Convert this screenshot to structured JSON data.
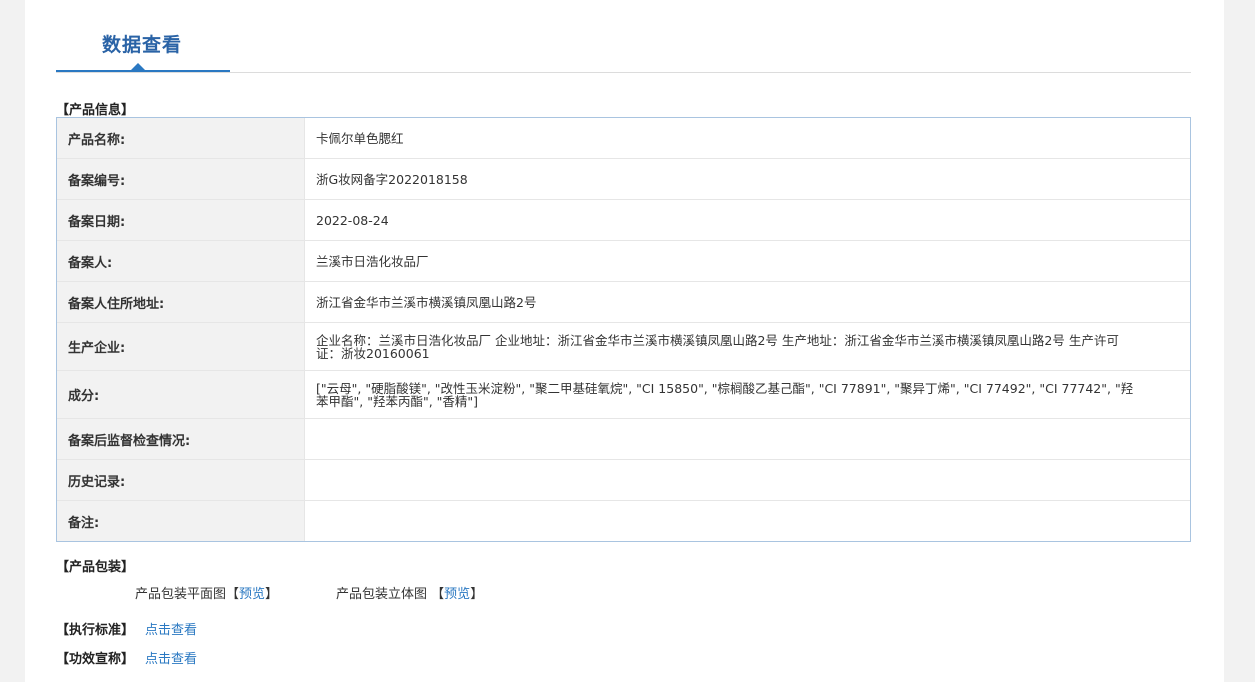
{
  "tab": {
    "title": "数据查看"
  },
  "sections": {
    "product_info": "【产品信息】",
    "product_packaging": "【产品包装】",
    "standard": "【执行标准】",
    "efficacy": "【功效宣称】"
  },
  "info_rows": [
    {
      "key": "产品名称:",
      "value": "卡佩尔单色腮红"
    },
    {
      "key": "备案编号:",
      "value": "浙G妆网备字2022018158"
    },
    {
      "key": "备案日期:",
      "value": "2022-08-24"
    },
    {
      "key": "备案人:",
      "value": "兰溪市日浩化妆品厂"
    },
    {
      "key": "备案人住所地址:",
      "value": "浙江省金华市兰溪市横溪镇凤凰山路2号"
    },
    {
      "key": "生产企业:",
      "value": "企业名称：兰溪市日浩化妆品厂 企业地址：浙江省金华市兰溪市横溪镇凤凰山路2号 生产地址：浙江省金华市兰溪市横溪镇凤凰山路2号 生产许可证：浙妆20160061"
    },
    {
      "key": "成分:",
      "value": "[\"云母\", \"硬脂酸镁\", \"改性玉米淀粉\", \"聚二甲基硅氧烷\", \"CI 15850\", \"棕榈酸乙基己酯\", \"CI 77891\", \"聚异丁烯\", \"CI 77492\", \"CI 77742\", \"羟苯甲酯\", \"羟苯丙酯\", \"香精\"]"
    },
    {
      "key": "备案后监督检查情况:",
      "value": ""
    },
    {
      "key": "历史记录:",
      "value": ""
    },
    {
      "key": "备注:",
      "value": ""
    }
  ],
  "packaging": {
    "flat_label": "产品包装平面图",
    "flat_open": "【",
    "flat_link": "预览",
    "flat_close": "】",
    "stereo_label": "产品包装立体图",
    "stereo_open": "【",
    "stereo_link": "预览",
    "stereo_close": "】"
  },
  "links": {
    "standard": "点击查看",
    "efficacy": "点击查看"
  }
}
